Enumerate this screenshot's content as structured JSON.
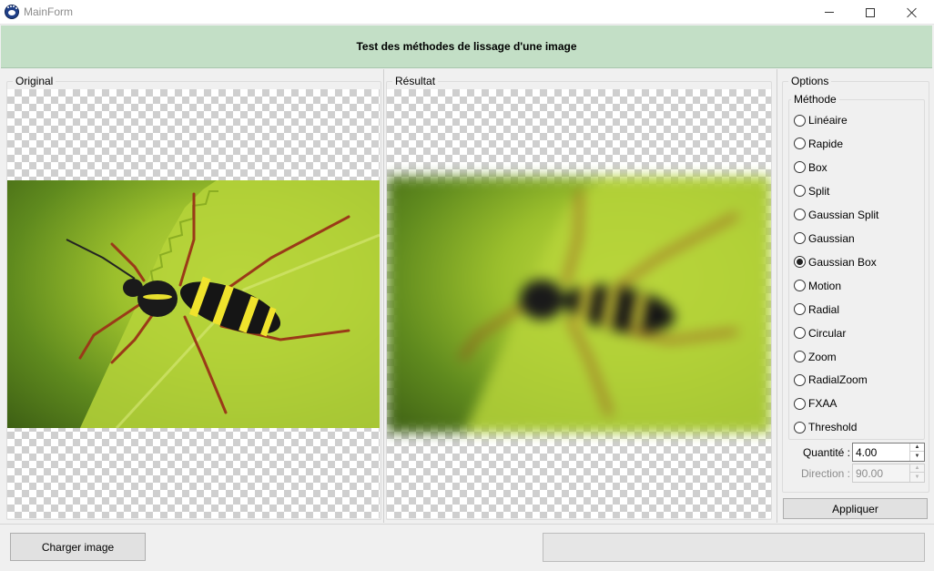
{
  "window": {
    "title": "MainForm",
    "icon": "paw-icon"
  },
  "banner": {
    "text": "Test des méthodes de lissage d'une image"
  },
  "panels": {
    "original_label": "Original",
    "result_label": "Résultat"
  },
  "options": {
    "group_label": "Options",
    "method_group_label": "Méthode",
    "methods": [
      "Linéaire",
      "Rapide",
      "Box",
      "Split",
      "Gaussian Split",
      "Gaussian",
      "Gaussian Box",
      "Motion",
      "Radial",
      "Circular",
      "Zoom",
      "RadialZoom",
      "FXAA",
      "Threshold"
    ],
    "selected_method": "Gaussian Box",
    "quantity_label": "Quantité :",
    "quantity_value": "4.00",
    "direction_label": "Direction :",
    "direction_value": "90.00",
    "direction_enabled": false,
    "apply_label": "Appliquer"
  },
  "footer": {
    "load_label": "Charger image",
    "progress": 0
  },
  "colors": {
    "banner_bg": "#c3dfc6",
    "window_bg": "#f0f0f0"
  }
}
